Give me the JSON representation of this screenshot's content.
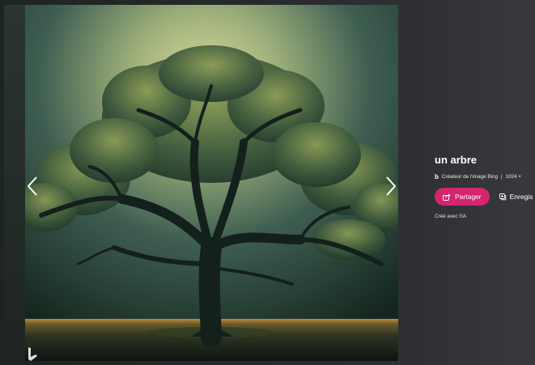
{
  "image": {
    "alt_icon": "bing-logo-icon"
  },
  "navigation": {
    "prev_icon": "chevron-left-icon",
    "next_icon": "chevron-right-icon"
  },
  "details": {
    "title": "un arbre",
    "source_letter": "b",
    "source": "Créateur de l'image Bing",
    "separator": "|",
    "size": "1024 ×",
    "share_label": "Partager",
    "save_label": "Enregis",
    "footnote": "Créé avec l'IA"
  },
  "colors": {
    "accent": "#d6246f",
    "background": "#2b2b2e"
  }
}
